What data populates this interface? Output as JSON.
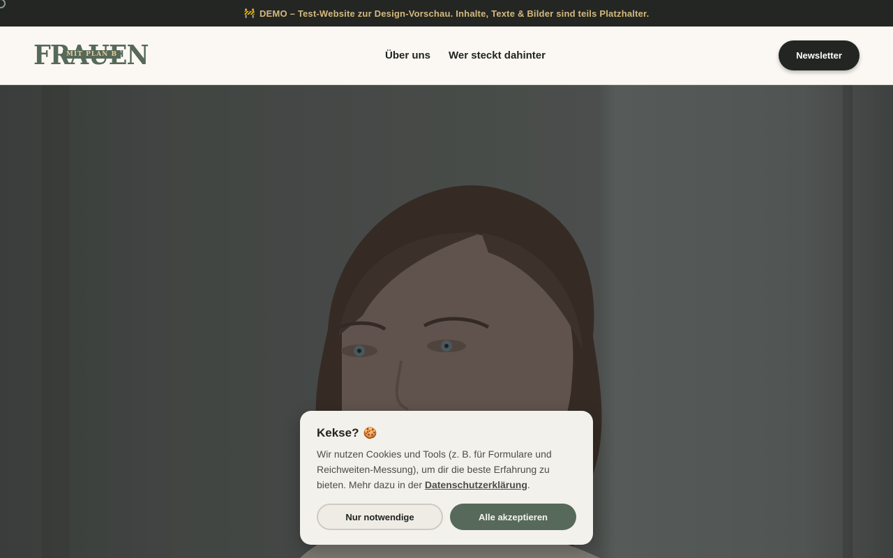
{
  "demo_banner": {
    "icon": "construction-barrier-icon",
    "text": "DEMO – Test-Website zur Design-Vorschau. Inhalte, Texte & Bilder sind teils Platzhalter."
  },
  "header": {
    "logo": {
      "word": "FRAUEN",
      "tagline": "MIT PLAN B"
    },
    "nav": [
      {
        "label": "Über uns"
      },
      {
        "label": "Wer steckt dahinter"
      }
    ],
    "newsletter_label": "Newsletter"
  },
  "hero": {
    "image": "portrait-photo-woman"
  },
  "cookie_dialog": {
    "title": "Kekse?",
    "title_icon": "cookie-icon",
    "text_before": "Wir nutzen Cookies und Tools (z. B. für Formulare und Reichweiten-Messung), um dir die beste Erfahrung zu bieten. Mehr dazu in der ",
    "link_label": "Datenschutzerklärung",
    "text_after": ".",
    "btn_necessary": "Nur notwendige",
    "btn_accept": "Alle akzeptieren"
  },
  "colors": {
    "brand_green": "#56695a",
    "accent_gold": "#d6b97c",
    "dark": "#232623",
    "cream": "#fbf8f3"
  }
}
